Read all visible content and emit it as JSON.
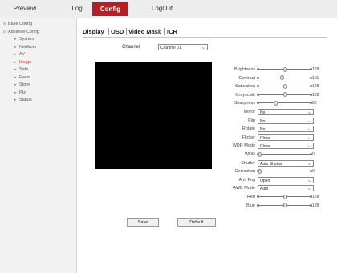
{
  "nav": {
    "preview": "Preview",
    "log": "Log",
    "config": "Config",
    "logout": "LogOut"
  },
  "sidebar": [
    {
      "label": "Base Config",
      "mk": "⊞",
      "level": 0
    },
    {
      "label": "Advance Config",
      "mk": "⊟",
      "level": 0
    },
    {
      "label": "System",
      "mk": "▸",
      "level": 1
    },
    {
      "label": "NetWork",
      "mk": "▸",
      "level": 1
    },
    {
      "label": "AV",
      "mk": "▸",
      "level": 1
    },
    {
      "label": "Image",
      "mk": "▸",
      "level": 1,
      "active": true
    },
    {
      "label": "Safe",
      "mk": "▸",
      "level": 1
    },
    {
      "label": "Event",
      "mk": "▸",
      "level": 1
    },
    {
      "label": "Store",
      "mk": "▸",
      "level": 1
    },
    {
      "label": "Ptz",
      "mk": "▸",
      "level": 1
    },
    {
      "label": "Status",
      "mk": "▸",
      "level": 1
    }
  ],
  "tabs": [
    "Display",
    "OSD",
    "Video Mask",
    "ICR"
  ],
  "channel": {
    "label": "Channel",
    "value": "Channel 01"
  },
  "settings": [
    {
      "label": "Brightness",
      "type": "slider",
      "value": 128,
      "max": 255,
      "display": "128"
    },
    {
      "label": "Contrast",
      "type": "slider",
      "value": 115,
      "max": 255,
      "display": "115"
    },
    {
      "label": "Saturation",
      "type": "slider",
      "value": 128,
      "max": 255,
      "display": "128"
    },
    {
      "label": "Grayscale",
      "type": "slider",
      "value": 128,
      "max": 255,
      "display": "128"
    },
    {
      "label": "Sharpness",
      "type": "slider",
      "value": 80,
      "max": 255,
      "display": "80"
    },
    {
      "label": "Mirror",
      "type": "select",
      "value": "No"
    },
    {
      "label": "Flip",
      "type": "select",
      "value": "No"
    },
    {
      "label": "Rotate",
      "type": "select",
      "value": "No"
    },
    {
      "label": "Flicker",
      "type": "select",
      "value": "Close"
    },
    {
      "label": "WDR Mode",
      "type": "select",
      "value": "Close"
    },
    {
      "label": "WDR",
      "type": "slider",
      "value": 0,
      "max": 255,
      "display": "0"
    },
    {
      "label": "Shutter",
      "type": "select",
      "value": "Auto Shutter"
    },
    {
      "label": "Correction",
      "type": "slider",
      "value": 0,
      "max": 255,
      "display": "0"
    },
    {
      "label": "Anti Fog",
      "type": "select",
      "value": "Open"
    },
    {
      "label": "AWB Mode",
      "type": "select",
      "value": "Auto"
    },
    {
      "label": "Red",
      "type": "slider",
      "value": 128,
      "max": 255,
      "display": "128"
    },
    {
      "label": "Blue",
      "type": "slider",
      "value": 128,
      "max": 255,
      "display": "128"
    }
  ],
  "buttons": {
    "save": "Save",
    "default": "Default"
  },
  "colors": {
    "accent": "#b51f24",
    "active_item": "#d0262d"
  }
}
